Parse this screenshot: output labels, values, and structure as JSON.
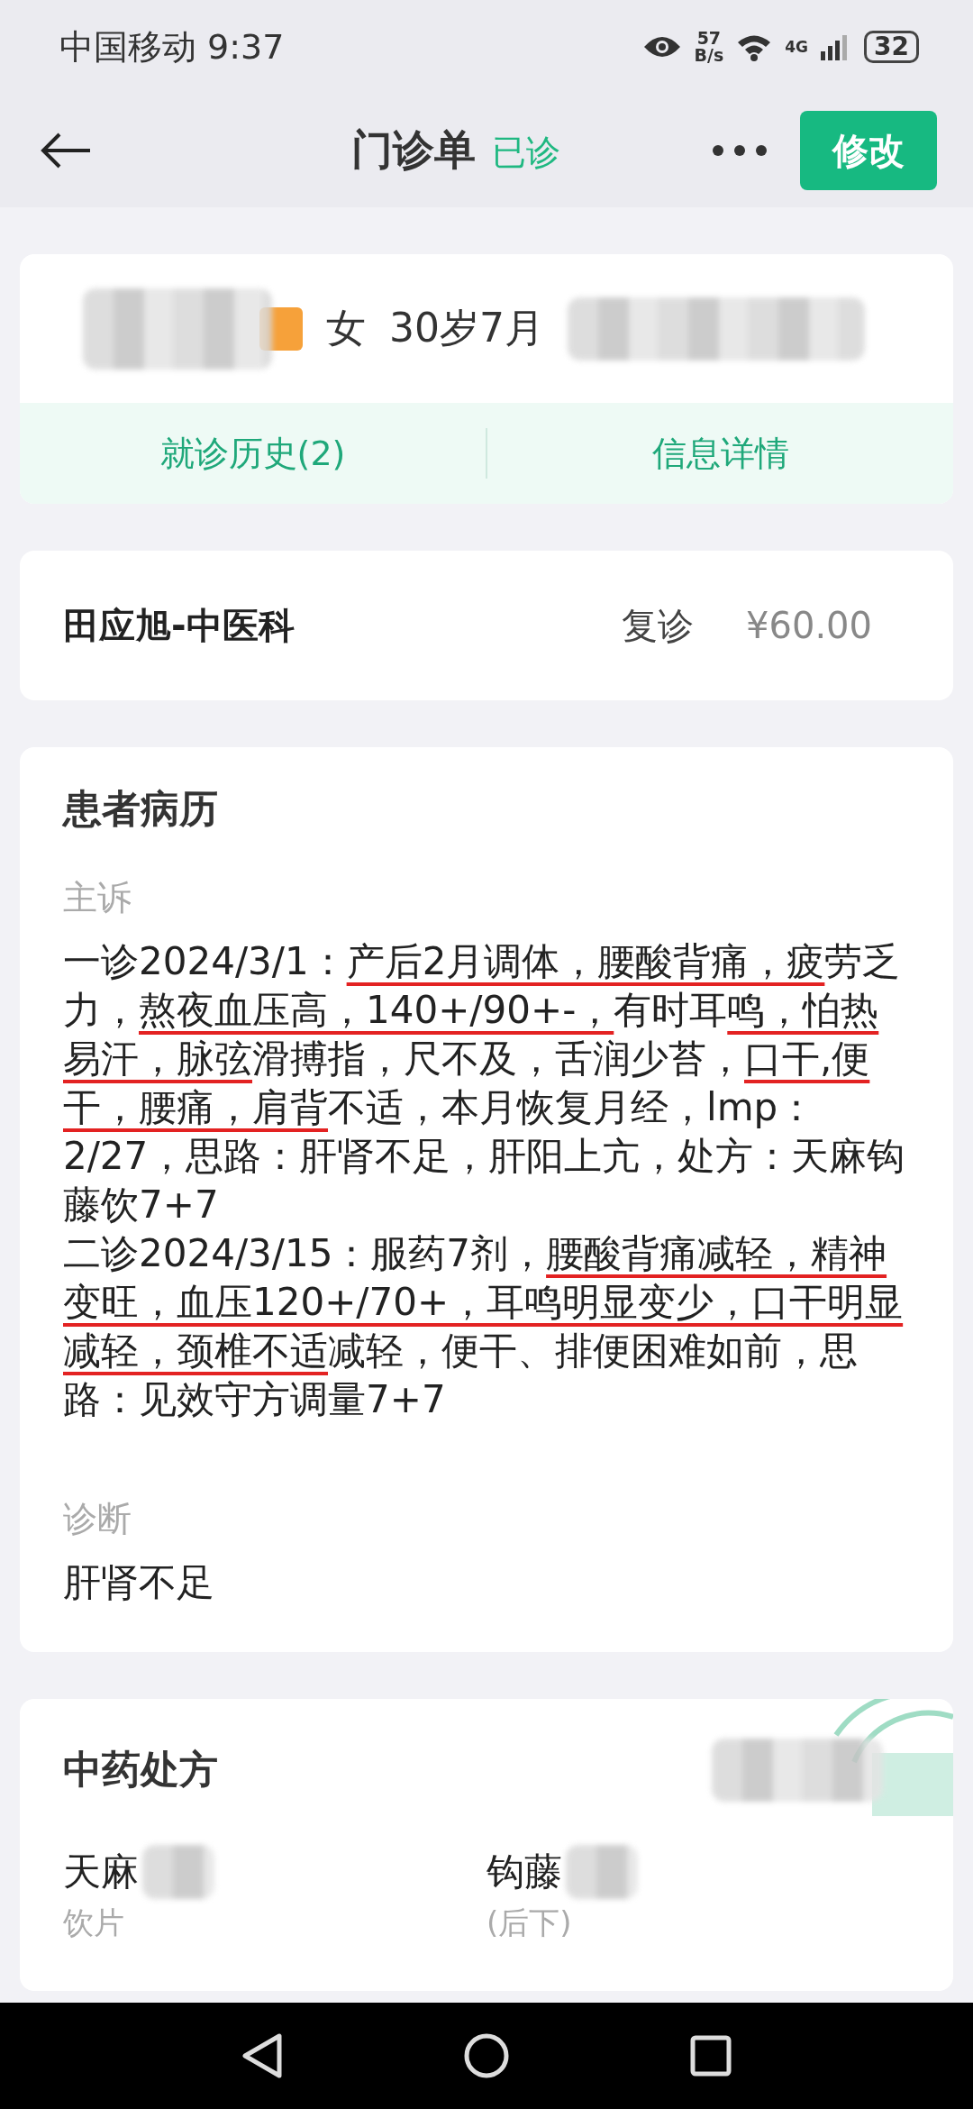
{
  "status_bar": {
    "carrier": "中国移动",
    "time": "9:37",
    "speed_value": "57",
    "speed_unit": "B/s",
    "network": "4G",
    "battery": "32"
  },
  "header": {
    "title": "门诊单",
    "status": "已诊",
    "edit_button": "修改"
  },
  "patient": {
    "gender": "女",
    "age": "30岁7月",
    "tabs": [
      {
        "label": "就诊历史(2)"
      },
      {
        "label": "信息详情"
      }
    ]
  },
  "visit": {
    "doctor": "田应旭-中医科",
    "type": "复诊",
    "fee": "¥60.00"
  },
  "record": {
    "title": "患者病历",
    "sections": [
      {
        "label": "主诉",
        "paragraphs": [
          [
            {
              "text": "一诊2024/3/1：",
              "marked": false
            },
            {
              "text": "产后2月调体，腰酸背痛，疲",
              "marked": true
            },
            {
              "text": "劳乏力，",
              "marked": false
            },
            {
              "text": "熬夜血压高，140+/90+-，",
              "marked": true
            },
            {
              "text": "有时耳",
              "marked": false
            },
            {
              "text": "鸣，怕热易汗，脉弦",
              "marked": true
            },
            {
              "text": "滑搏指，尺不及，舌润少苔，",
              "marked": false
            },
            {
              "text": "口干,便干，腰痛，肩背",
              "marked": true
            },
            {
              "text": "不适，本月恢复月经，lmp：2/27，思路：肝肾不足，肝阳上亢，处方：天麻钩藤饮7+7",
              "marked": false
            }
          ],
          [
            {
              "text": "二诊2024/3/15：服药7剂，",
              "marked": false
            },
            {
              "text": "腰酸背痛减轻，精神变旺，血压120+/70+，耳鸣明显变少，口干明显减轻，颈椎不适",
              "marked": true
            },
            {
              "text": "减轻，便干、排便困难如前，思路：见效守方调量7+7",
              "marked": false
            }
          ]
        ]
      },
      {
        "label": "诊断",
        "paragraphs": [
          [
            {
              "text": "肝肾不足",
              "marked": false
            }
          ]
        ]
      }
    ]
  },
  "prescription": {
    "title": "中药处方",
    "items": [
      {
        "name": "天麻",
        "note": "饮片"
      },
      {
        "name": "钩藤",
        "note": "(后下)"
      }
    ]
  }
}
